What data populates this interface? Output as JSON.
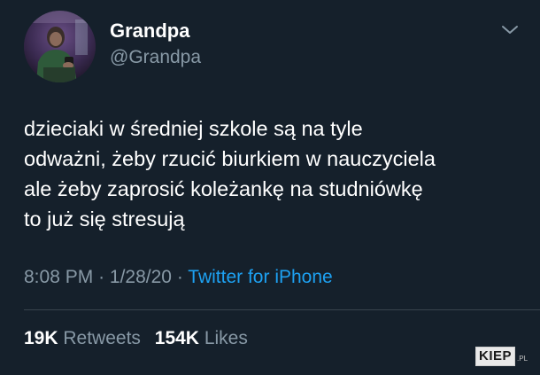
{
  "author": {
    "display_name": "Grandpa",
    "handle": "@Grandpa",
    "avatar_icon": "profile-photo"
  },
  "menu_icon": "chevron-down-icon",
  "tweet": {
    "lines": [
      "dzieciaki w średniej szkole są na tyle",
      "odważni, żeby rzucić biurkiem w nauczyciela",
      "ale żeby zaprosić koleżankę na studniówkę",
      "to już się stresują"
    ]
  },
  "meta": {
    "time": "8:08 PM",
    "separator": "·",
    "date": "1/28/20",
    "source": "Twitter for iPhone"
  },
  "stats": {
    "retweets_count": "19K",
    "retweets_label": "Retweets",
    "likes_count": "154K",
    "likes_label": "Likes"
  },
  "watermark": {
    "text": "KIEP",
    "suffix": ".PL"
  },
  "colors": {
    "background": "#15202b",
    "text": "#ffffff",
    "secondary": "#8899a6",
    "link": "#1da1f2",
    "divider": "#38444d"
  }
}
